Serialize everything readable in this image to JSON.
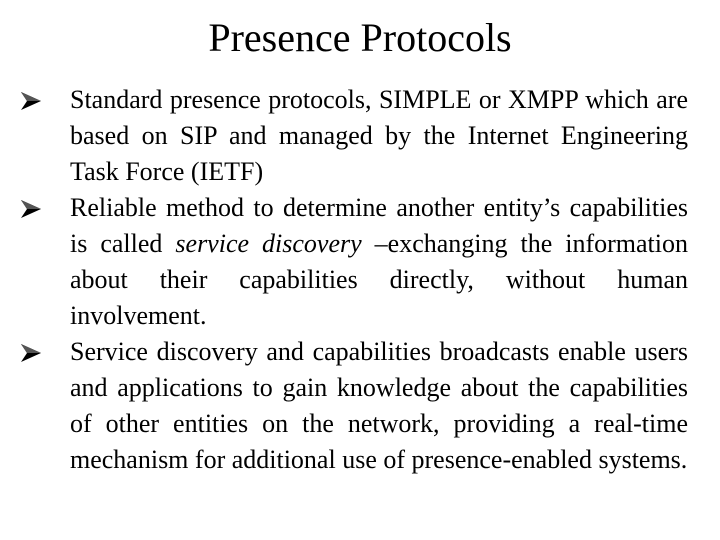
{
  "slide": {
    "title": "Presence Protocols",
    "bullet_icon": "arrow-bullet-icon",
    "bullets": [
      {
        "text": "Standard presence protocols, SIMPLE or XMPP which  are based on SIP and managed by the Internet Engineering Task Force (IETF)"
      },
      {
        "text_before": "Reliable method to determine another entity’s capabilities is called ",
        "text_italic": "service discovery",
        "text_after": " –exchanging the information about their capabilities directly, without human involvement."
      },
      {
        "text": "Service discovery and capabilities broadcasts enable users and applications to gain knowledge about the capabilities of other entities on the network, providing a real-time mechanism for additional use of presence-enabled systems."
      }
    ]
  }
}
